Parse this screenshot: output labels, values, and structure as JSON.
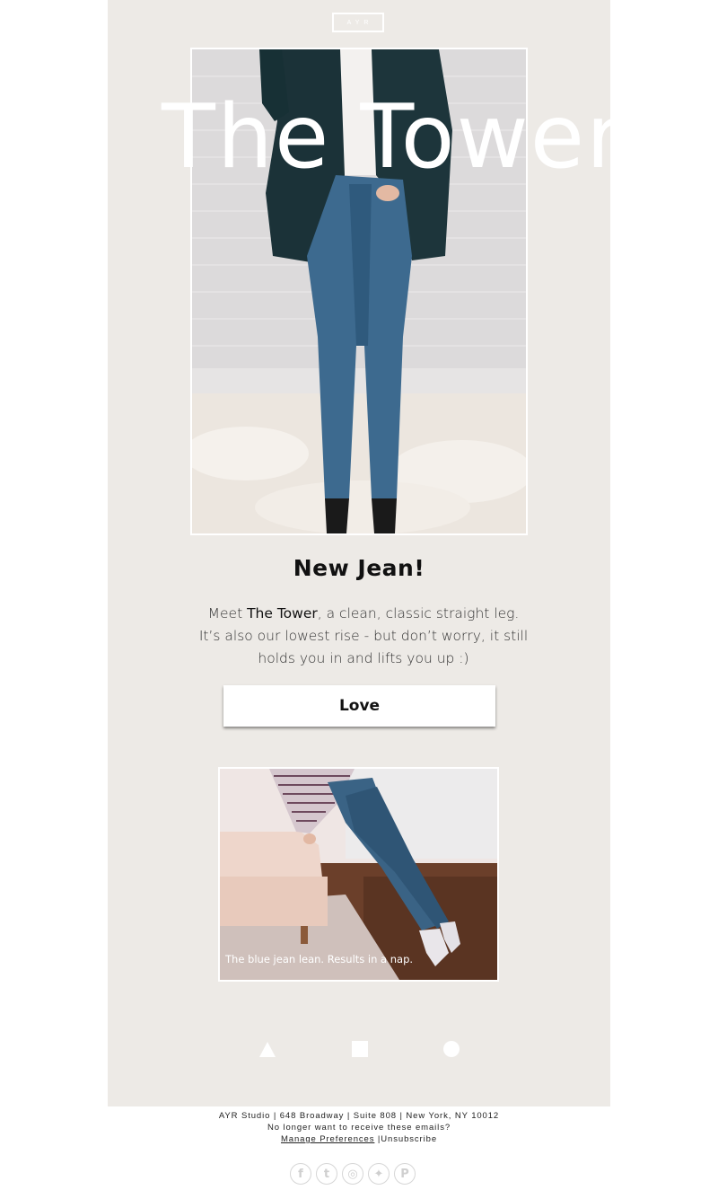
{
  "header": {
    "logo_text": "AYR"
  },
  "hero": {
    "title": "The Tower",
    "image_alt": "Woman wearing straight leg jeans and a dark blazer"
  },
  "main": {
    "headline": "New Jean!",
    "body_prefix": "Meet ",
    "body_bold": "The Tower",
    "body_suffix": ", a clean, classic straight leg. It’s also our lowest rise - but don’t worry, it still holds you in and lifts you up :)",
    "cta_label": "Love"
  },
  "promo": {
    "caption": "The blue jean lean. Results in a nap."
  },
  "shape_nav": [
    {
      "name": "triangle-icon"
    },
    {
      "name": "square-icon"
    },
    {
      "name": "circle-icon"
    }
  ],
  "footer": {
    "address": "AYR Studio | 648 Broadway | Suite 808 | New York, NY 10012",
    "unsubscribe_prompt": "No longer want to receive these emails?",
    "manage_preferences": "Manage Preferences",
    "separator": " |",
    "unsubscribe": "Unsubscribe"
  },
  "social": [
    {
      "name": "facebook-icon",
      "glyph": "f"
    },
    {
      "name": "tumblr-icon",
      "glyph": "t"
    },
    {
      "name": "instagram-icon",
      "glyph": "◎"
    },
    {
      "name": "twitter-icon",
      "glyph": "✦"
    },
    {
      "name": "pinterest-icon",
      "glyph": "P"
    }
  ],
  "colors": {
    "email_background": "#edeae6",
    "page_background": "#ffffff",
    "text_primary": "#111111",
    "accent_white": "#ffffff"
  }
}
